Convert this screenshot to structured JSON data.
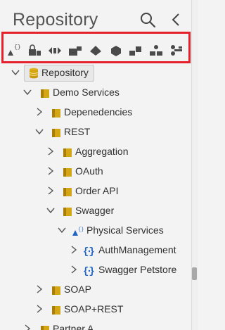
{
  "header": {
    "title": "Repository",
    "search_icon": "search-icon",
    "collapse_icon": "chevron-left-icon"
  },
  "toolbar": {
    "buttons": [
      {
        "name": "add-api-button",
        "icon": "api-triangle-icon"
      },
      {
        "name": "lock-button",
        "icon": "lock-icon"
      },
      {
        "name": "code-button",
        "icon": "code-diamond-icon"
      },
      {
        "name": "folder-shape-button",
        "icon": "folder-shape-icon"
      },
      {
        "name": "tag-button",
        "icon": "tag-icon"
      },
      {
        "name": "cube-button",
        "icon": "cube-icon"
      },
      {
        "name": "blocks-button",
        "icon": "blocks-icon"
      },
      {
        "name": "users-button",
        "icon": "users-icon"
      },
      {
        "name": "connect-button",
        "icon": "connect-icon"
      }
    ]
  },
  "tree": {
    "root": "Repository",
    "demo_services": "Demo Services",
    "dependencies": "Depenedencies",
    "rest": "REST",
    "aggregation": "Aggregation",
    "oauth": "OAuth",
    "order_api": "Order API",
    "swagger": "Swagger",
    "physical_services": "Physical Services",
    "auth_management": "AuthManagement",
    "swagger_petstore": "Swagger Petstore",
    "soap": "SOAP",
    "soap_rest": "SOAP+REST",
    "partner_a": "Partner A"
  },
  "colors": {
    "folder": "#d4a514",
    "folder_dark": "#a97f08",
    "api_blue": "#1e63c4",
    "icon_gray": "#4a4a4a",
    "highlight": "#e5212b"
  }
}
